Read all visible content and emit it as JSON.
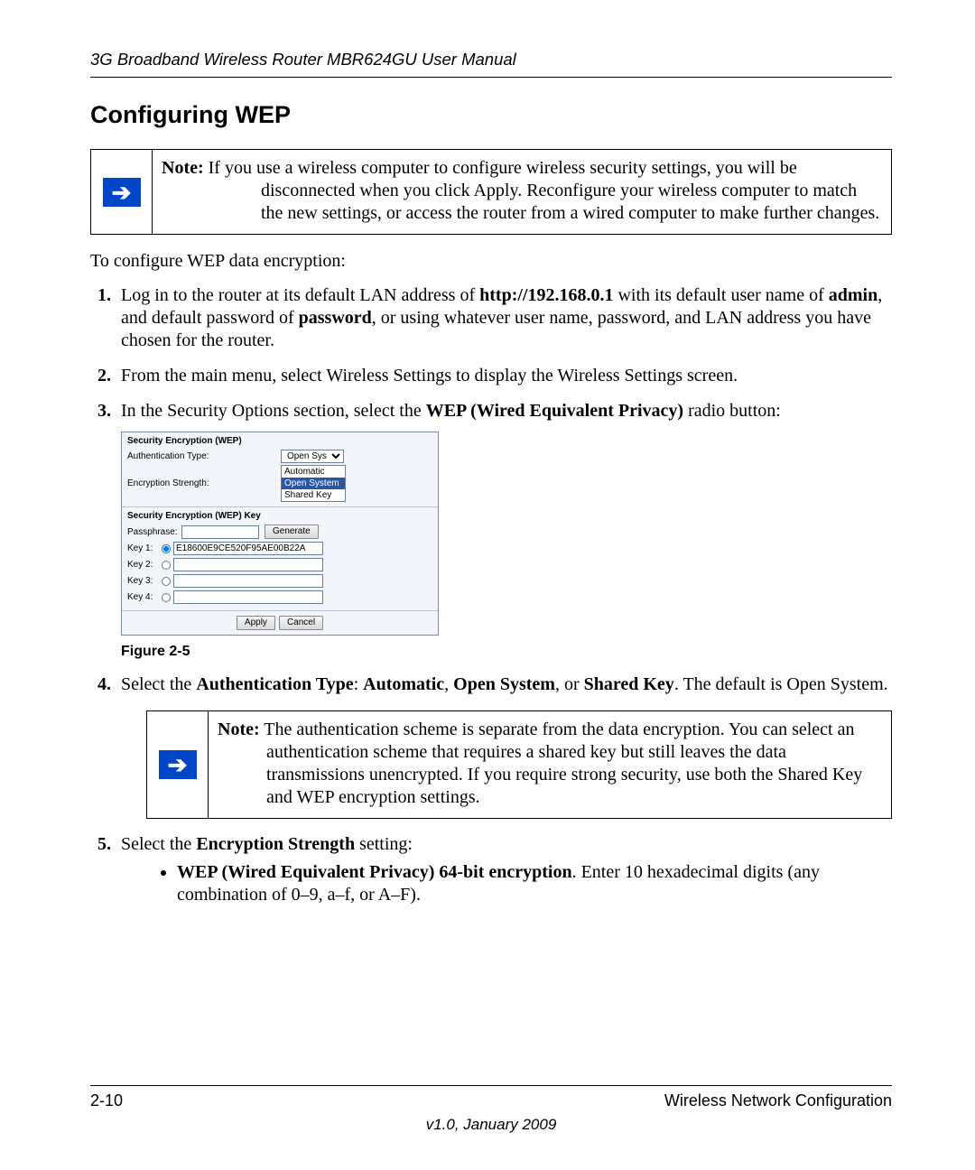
{
  "header": {
    "running_title": "3G Broadband Wireless Router MBR624GU User Manual"
  },
  "section": {
    "title": "Configuring WEP"
  },
  "note1": {
    "label": "Note:",
    "text": " If you use a wireless computer to configure wireless security settings, you will be disconnected when you click Apply. Reconfigure your wireless computer to match the new settings, or access the router from a wired computer to make further changes."
  },
  "intro_p": "To configure WEP data encryption:",
  "steps": {
    "s1_a": "Log in to the router at its default LAN address of ",
    "s1_b_bold": "http://192.168.0.1",
    "s1_c": " with its default user name of ",
    "s1_d_bold": "admin",
    "s1_e": ", and default password of ",
    "s1_f_bold": "password",
    "s1_g": ", or using whatever user name, password, and LAN address you have chosen for the router.",
    "s2": "From the main menu, select Wireless Settings to display the Wireless Settings screen.",
    "s3_a": "In the Security Options section, select the ",
    "s3_b_bold": "WEP (Wired Equivalent Privacy)",
    "s3_c": " radio button:",
    "s4_a": "Select the ",
    "s4_b_bold": "Authentication Type",
    "s4_c": ": ",
    "s4_d_bold": "Automatic",
    "s4_e": ", ",
    "s4_f_bold": "Open System",
    "s4_g": ", or ",
    "s4_h_bold": "Shared Key",
    "s4_i": ". The default is Open System.",
    "s5_a": "Select the ",
    "s5_b_bold": "Encryption Strength",
    "s5_c": " setting:",
    "s5_bullet_a_bold": "WEP (Wired Equivalent Privacy) 64-bit encryption",
    "s5_bullet_a_rest": ". Enter 10 hexadecimal digits (any combination of 0–9, a–f, or A–F)."
  },
  "figure": {
    "caption": "Figure 2-5",
    "panel": {
      "sec1_title": "Security Encryption (WEP)",
      "auth_label": "Authentication Type:",
      "auth_value": "Open System",
      "enc_label": "Encryption Strength:",
      "dd_automatic": "Automatic",
      "dd_open": "Open System",
      "dd_shared": "Shared Key",
      "sec2_title": "Security Encryption (WEP) Key",
      "pass_label": "Passphrase:",
      "gen_btn": "Generate",
      "key1_label": "Key 1:",
      "key1_value": "E18600E9CE520F95AE00B22A",
      "key2_label": "Key 2:",
      "key3_label": "Key 3:",
      "key4_label": "Key 4:",
      "apply_btn": "Apply",
      "cancel_btn": "Cancel"
    }
  },
  "note2": {
    "label": "Note:",
    "text": " The authentication scheme is separate from the data encryption. You can select an authentication scheme that requires a shared key but still leaves the data transmissions unencrypted. If you require strong security, use both the Shared Key and WEP encryption settings."
  },
  "footer": {
    "page_num": "2-10",
    "section_name": "Wireless Network Configuration",
    "version": "v1.0, January 2009"
  }
}
